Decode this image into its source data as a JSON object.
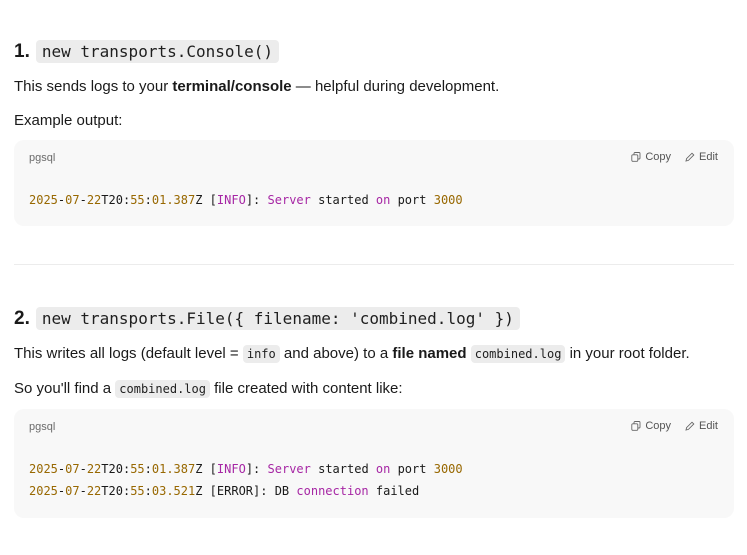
{
  "section1": {
    "number": "1.",
    "code": "new transports.Console()",
    "para1": {
      "pre": "This sends logs to your ",
      "bold": "terminal/console",
      "post": " — helpful during development."
    },
    "para2": "Example output:",
    "block": {
      "lang": "pgsql",
      "copy": "Copy",
      "edit": "Edit",
      "lines": [
        [
          {
            "t": "2025",
            "c": "num"
          },
          {
            "t": "-",
            "c": "plain"
          },
          {
            "t": "07",
            "c": "num"
          },
          {
            "t": "-",
            "c": "plain"
          },
          {
            "t": "22",
            "c": "num"
          },
          {
            "t": "T20:",
            "c": "plain"
          },
          {
            "t": "55",
            "c": "num"
          },
          {
            "t": ":",
            "c": "plain"
          },
          {
            "t": "01.387",
            "c": "num"
          },
          {
            "t": "Z [",
            "c": "plain"
          },
          {
            "t": "INFO",
            "c": "kw"
          },
          {
            "t": "]: ",
            "c": "plain"
          },
          {
            "t": "Server",
            "c": "kw"
          },
          {
            "t": " started ",
            "c": "plain"
          },
          {
            "t": "on",
            "c": "kw"
          },
          {
            "t": " port ",
            "c": "plain"
          },
          {
            "t": "3000",
            "c": "num"
          }
        ]
      ]
    }
  },
  "section2": {
    "number": "2.",
    "code": "new transports.File({ filename: 'combined.log' })",
    "para1": {
      "a": "This writes all logs (default level = ",
      "code1": "info",
      "b": " and above) to a ",
      "bold": "file named",
      "c": " ",
      "code2": "combined.log",
      "d": " in your root folder."
    },
    "para2": {
      "a": "So you'll find a ",
      "code": "combined.log",
      "b": " file created with content like:"
    },
    "block": {
      "lang": "pgsql",
      "copy": "Copy",
      "edit": "Edit",
      "lines": [
        [
          {
            "t": "2025",
            "c": "num"
          },
          {
            "t": "-",
            "c": "plain"
          },
          {
            "t": "07",
            "c": "num"
          },
          {
            "t": "-",
            "c": "plain"
          },
          {
            "t": "22",
            "c": "num"
          },
          {
            "t": "T20:",
            "c": "plain"
          },
          {
            "t": "55",
            "c": "num"
          },
          {
            "t": ":",
            "c": "plain"
          },
          {
            "t": "01.387",
            "c": "num"
          },
          {
            "t": "Z [",
            "c": "plain"
          },
          {
            "t": "INFO",
            "c": "kw"
          },
          {
            "t": "]: ",
            "c": "plain"
          },
          {
            "t": "Server",
            "c": "kw"
          },
          {
            "t": " started ",
            "c": "plain"
          },
          {
            "t": "on",
            "c": "kw"
          },
          {
            "t": " port ",
            "c": "plain"
          },
          {
            "t": "3000",
            "c": "num"
          }
        ],
        [
          {
            "t": "2025",
            "c": "num"
          },
          {
            "t": "-",
            "c": "plain"
          },
          {
            "t": "07",
            "c": "num"
          },
          {
            "t": "-",
            "c": "plain"
          },
          {
            "t": "22",
            "c": "num"
          },
          {
            "t": "T20:",
            "c": "plain"
          },
          {
            "t": "55",
            "c": "num"
          },
          {
            "t": ":",
            "c": "plain"
          },
          {
            "t": "03.521",
            "c": "num"
          },
          {
            "t": "Z [ERROR]: DB ",
            "c": "plain"
          },
          {
            "t": "connection",
            "c": "kw"
          },
          {
            "t": " failed",
            "c": "plain"
          }
        ]
      ]
    }
  },
  "colors": {
    "number": "#986801",
    "keyword": "#a626a4",
    "code_bg": "#f8f8f8",
    "inline_code_bg": "#ececec"
  },
  "icons": {
    "copy": "copy-icon",
    "edit": "edit-icon"
  }
}
